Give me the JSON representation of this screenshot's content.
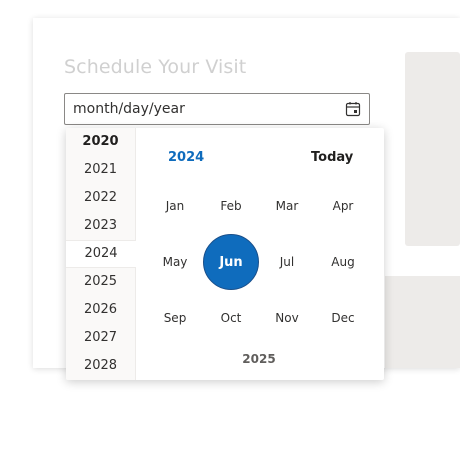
{
  "heading": "Schedule Your Visit",
  "date_input": {
    "value": "month/day/year"
  },
  "picker": {
    "years": [
      "2020",
      "2021",
      "2022",
      "2023",
      "2024",
      "2025",
      "2026",
      "2027",
      "2028"
    ],
    "current_year": "2024",
    "today_label": "Today",
    "months": [
      "Jan",
      "Feb",
      "Mar",
      "Apr",
      "May",
      "Jun",
      "Jul",
      "Aug",
      "Sep",
      "Oct",
      "Nov",
      "Dec"
    ],
    "selected_month": "Jun",
    "next_year": "2025"
  },
  "colors": {
    "accent": "#0f6cbd",
    "panel": "#edebe9"
  }
}
